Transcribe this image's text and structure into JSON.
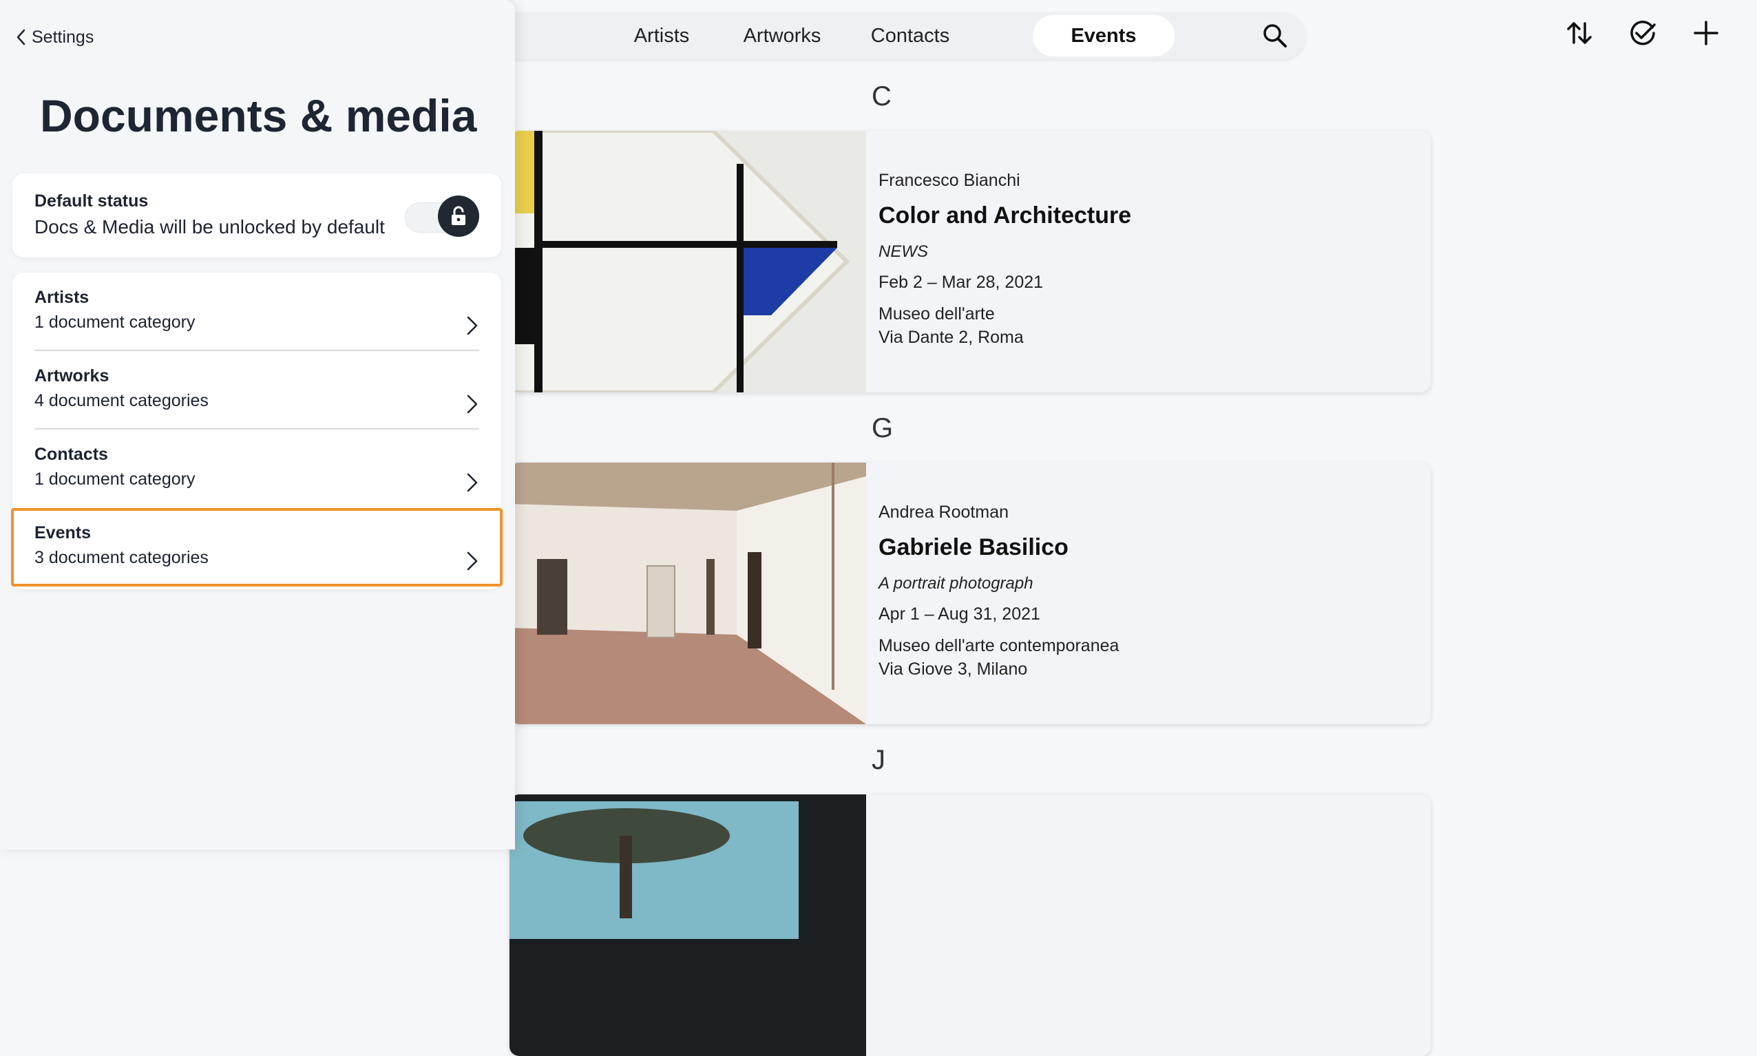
{
  "nav": {
    "tabs": [
      {
        "label": "Artists"
      },
      {
        "label": "Artworks"
      },
      {
        "label": "Contacts"
      },
      {
        "label": "Events",
        "active": true
      }
    ],
    "icons": [
      "search-icon",
      "sort-icon",
      "select-check-icon",
      "add-icon"
    ]
  },
  "content": {
    "sections": [
      {
        "letter": "C"
      },
      {
        "letter": "G"
      },
      {
        "letter": "J"
      }
    ],
    "cards": [
      {
        "artist": "Francesco Bianchi",
        "title": "Color and Architecture",
        "subtitle": "NEWS",
        "dates": "Feb 2 – Mar 28, 2021",
        "venue": "Museo dell'arte",
        "address": "Via Dante 2, Roma"
      },
      {
        "artist": "Andrea Rootman",
        "title": "Gabriele Basilico",
        "subtitle": "A portrait photograph",
        "dates": "Apr 1 – Aug 31, 2021",
        "venue": "Museo dell'arte contemporanea",
        "address": "Via Giove 3, Milano"
      }
    ]
  },
  "panel": {
    "back_label": "Settings",
    "title": "Documents & media",
    "default_status": {
      "label": "Default status",
      "description": "Docs & Media will be unlocked by default",
      "toggle_on": false,
      "icon": "lock-icon"
    },
    "items": [
      {
        "title": "Artists",
        "subtitle": "1 document category"
      },
      {
        "title": "Artworks",
        "subtitle": "4 document categories"
      },
      {
        "title": "Contacts",
        "subtitle": "1 document category"
      },
      {
        "title": "Events",
        "subtitle": "3 document categories",
        "selected": true
      }
    ]
  },
  "colors": {
    "accent_selection": "#f0922b",
    "dark": "#222831",
    "background": "#f6f7f9"
  }
}
